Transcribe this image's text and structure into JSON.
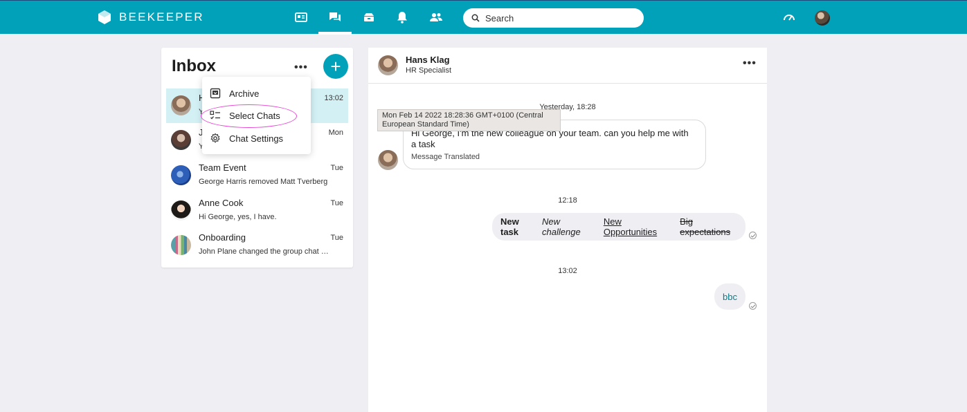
{
  "app": {
    "brand": "BEEKEEPER"
  },
  "topbar": {
    "nav": [
      {
        "icon": "newsfeed-icon"
      },
      {
        "icon": "chat-icon",
        "active": true
      },
      {
        "icon": "apps-icon"
      },
      {
        "icon": "bell-icon"
      },
      {
        "icon": "people-icon"
      }
    ],
    "search_placeholder": "Search",
    "right_icons": [
      "speedometer-icon",
      "user-avatar"
    ],
    "accent_color": "#00a1b9"
  },
  "inbox": {
    "title": "Inbox",
    "chats": [
      {
        "name": "H",
        "preview": "Y",
        "time": "13:02",
        "active": true
      },
      {
        "name": "J",
        "preview": "Y",
        "time": "Mon"
      },
      {
        "name": "Team Event",
        "preview": "George Harris removed Matt Tverberg",
        "time": "Tue"
      },
      {
        "name": "Anne Cook",
        "preview": "Hi George, yes, I have.",
        "time": "Tue"
      },
      {
        "name": "Onboarding",
        "preview": "John Plane changed the group chat name",
        "time": "Tue"
      }
    ]
  },
  "dropdown": {
    "items": [
      {
        "label": "Archive",
        "icon": "archive-icon"
      },
      {
        "label": "Select Chats",
        "icon": "checklist-icon",
        "highlighted": true
      },
      {
        "label": "Chat Settings",
        "icon": "gear-icon"
      }
    ]
  },
  "conversation": {
    "contact_name": "Hans Klag",
    "contact_role": "HR Specialist",
    "sep1": "Yesterday, 18:28",
    "tooltip": "Mon Feb 14 2022 18:28:36 GMT+0100 (Central European Standard Time)",
    "incoming_text": "Hi George, I'm the new colleague on your team. can you help me with a task",
    "incoming_sub": "Message Translated",
    "sep2": "12:18",
    "out1": {
      "bold": "New task",
      "italic": "New challenge",
      "underline": "New Opportunities",
      "strike": "Big expectations"
    },
    "sep3": "13:02",
    "out2": "bbc"
  }
}
